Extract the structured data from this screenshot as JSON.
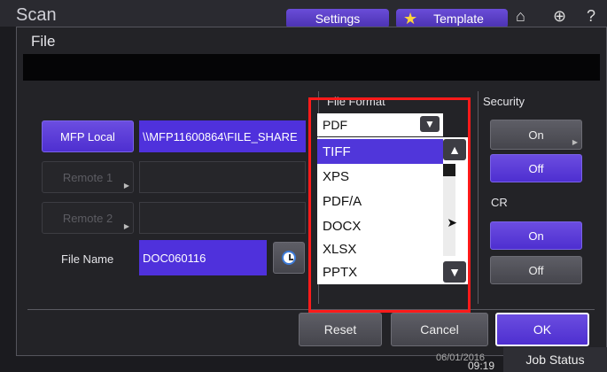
{
  "app": {
    "title": "Scan"
  },
  "topbar": {
    "settings_label": "Settings",
    "template_label": "Template"
  },
  "dialog": {
    "title": "File",
    "destinations": {
      "mfp_local": "MFP Local",
      "mfp_path": "\\\\MFP11600864\\FILE_SHARE",
      "remote1": "Remote 1",
      "remote2": "Remote 2"
    },
    "file_name": {
      "label": "File Name",
      "value": "DOC060116"
    },
    "file_format": {
      "label": "File Format",
      "selected": "PDF",
      "options": [
        "TIFF",
        "XPS",
        "PDF/A",
        "DOCX",
        "XLSX",
        "PPTX"
      ],
      "highlighted": "TIFF"
    },
    "security": {
      "label": "Security",
      "on": "On",
      "off": "Off"
    },
    "ocr": {
      "label_partial": "CR",
      "on": "On",
      "off": "Off"
    },
    "buttons": {
      "reset": "Reset",
      "cancel": "Cancel",
      "ok": "OK"
    }
  },
  "statusbar": {
    "time": "09:19",
    "date_partial": "06/01/2016",
    "job_status": "Job Status"
  },
  "colors": {
    "accent": "#5036da",
    "highlight_box": "#ff1a1a"
  }
}
